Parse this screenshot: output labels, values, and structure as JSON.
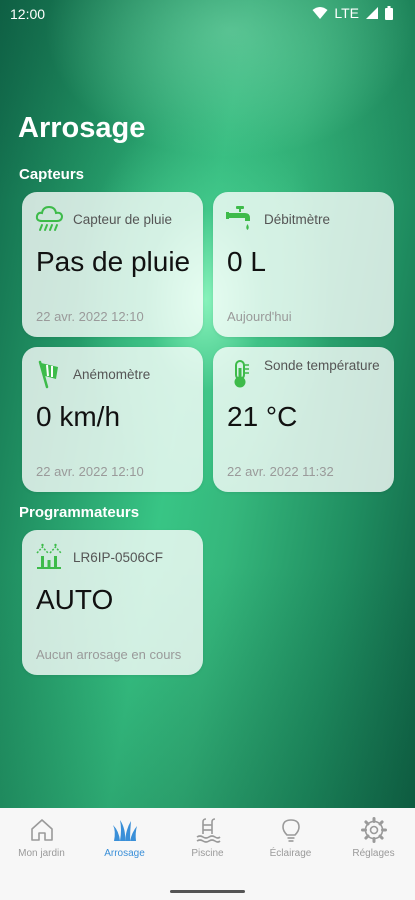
{
  "status_bar": {
    "time": "12:00",
    "network": "LTE"
  },
  "page": {
    "title": "Arrosage"
  },
  "sections": {
    "sensors": "Capteurs",
    "controllers": "Programmateurs"
  },
  "cards": {
    "rain": {
      "label": "Capteur de pluie",
      "value": "Pas de pluie",
      "sub": "22 avr. 2022 12:10"
    },
    "flow": {
      "label": "Débitmètre",
      "value": "0 L",
      "sub": "Aujourd'hui"
    },
    "wind": {
      "label": "Anémomètre",
      "value": "0 km/h",
      "sub": "22 avr. 2022 12:10"
    },
    "temp": {
      "label": "Sonde température",
      "value": "21 °C",
      "sub": "22 avr. 2022 11:32"
    },
    "controller": {
      "label": "LR6IP-0506CF",
      "value": "AUTO",
      "sub": "Aucun arrosage en cours"
    }
  },
  "nav": {
    "items": [
      {
        "label": "Mon jardin"
      },
      {
        "label": "Arrosage"
      },
      {
        "label": "Piscine"
      },
      {
        "label": "Éclairage"
      },
      {
        "label": "Réglages"
      }
    ],
    "active_color": "#3a8fd8",
    "inactive_color": "#9a9a9a"
  },
  "colors": {
    "accent_green": "#3dbb4a"
  }
}
